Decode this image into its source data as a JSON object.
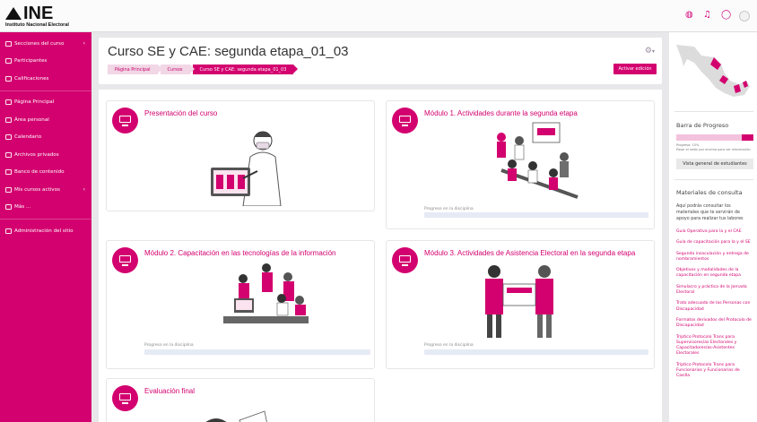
{
  "logo": {
    "name": "INE",
    "subtitle": "Instituto Nacional Electoral"
  },
  "topbar": {
    "icons": [
      "globe-icon",
      "bell-icon",
      "chat-icon",
      "user-avatar"
    ]
  },
  "sidebar": {
    "items": [
      {
        "label": "Secciones del curso",
        "icon": "sections-icon",
        "chevron": "‹"
      },
      {
        "label": "Participantes",
        "icon": "participants-icon"
      },
      {
        "label": "Calificaciones",
        "icon": "grades-icon"
      },
      {
        "label": "Página Principal",
        "icon": "home-icon"
      },
      {
        "label": "Área personal",
        "icon": "dashboard-icon"
      },
      {
        "label": "Calendario",
        "icon": "calendar-icon"
      },
      {
        "label": "Archivos privados",
        "icon": "files-icon"
      },
      {
        "label": "Banco de contenido",
        "icon": "content-bank-icon"
      },
      {
        "label": "Mis cursos activos",
        "icon": "courses-icon",
        "chevron": "‹"
      },
      {
        "label": "Más ...",
        "icon": "folder-icon"
      },
      {
        "label": "Administración del sitio",
        "icon": "admin-icon"
      }
    ]
  },
  "header": {
    "title": "Curso SE y CAE: segunda etapa_01_03",
    "breadcrumb": [
      "Página Principal",
      "Cursos",
      "Curso SE y CAE: segunda etapa_01_03"
    ],
    "gear": "⚙",
    "edit_button": "Activar edición"
  },
  "cards": [
    {
      "title": "Presentación del curso"
    },
    {
      "title": "Módulo 1. Actividades durante la segunda etapa",
      "progress_label": "Progreso en la disciplina"
    },
    {
      "title": "Módulo 2. Capacitación en las tecnologías de la información",
      "progress_label": "Progreso en la disciplina"
    },
    {
      "title": "Módulo 3. Actividades de Asistencia Electoral en la segunda etapa",
      "progress_label": "Progreso en la disciplina"
    },
    {
      "title": "Evaluación final"
    }
  ],
  "right_panel": {
    "progress_title": "Barra de Progreso",
    "progress_pct_text": "Progreso: 15%",
    "progress_hint": "Pasar el ratón por encima para ver información",
    "progress_value": 0.15,
    "overview_button": "Vista general de estudiantes",
    "materials_title": "Materiales de consulta",
    "materials_intro": "Aquí podrás consultar los materiales que te servirán de apoyo para realizar tus labores",
    "links": [
      "Guía Operativa para la y el CAE",
      "Guía de capacitación para la y el SE",
      "Segunda insaculación y entrega de nombramientos",
      "Objetivos y modalidades de la capacitación en segunda etapa",
      "Simulacro y práctica de la Jornada Electoral",
      "Trato adecuado de las Personas con Discapacidad",
      "Formatos derivados del Protocolo de Discapacidad",
      "Tríptico Protocolo Trans para Supervisores/as Electorales y Capacitadores/as-Asistentes Electorales",
      "Tríptico Protocolo Trans para Funcionarios y Funcionarias de Casilla"
    ]
  },
  "colors": {
    "accent": "#d3006f",
    "accent_light": "#f2d7e6"
  }
}
